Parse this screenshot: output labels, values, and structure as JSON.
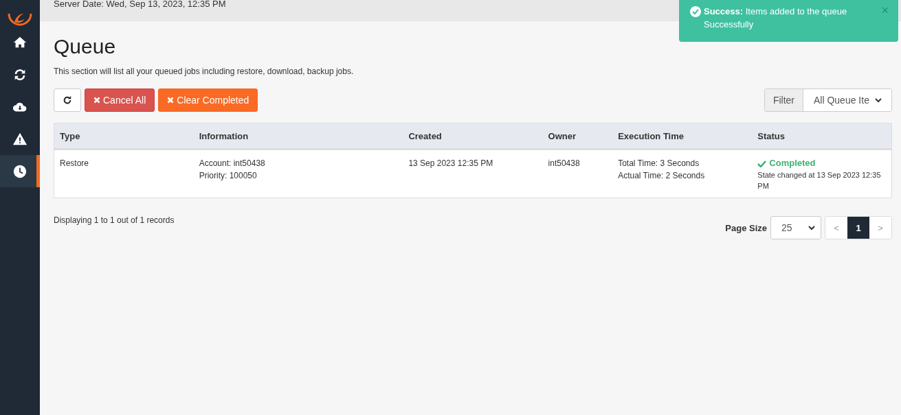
{
  "header": {
    "server_date": "Server Date: Wed, Sep 13, 2023, 12:35 PM"
  },
  "sidebar": {
    "items": [
      {
        "selected": false
      },
      {
        "selected": false
      },
      {
        "selected": false
      },
      {
        "selected": false
      },
      {
        "selected": true
      }
    ]
  },
  "page": {
    "title": "Queue",
    "description": "This section will list all your queued jobs including restore, download, backup jobs."
  },
  "toolbar": {
    "buttons": [
      {
        "kind": "refresh"
      },
      {
        "kind": "danger",
        "label": "Cancel All"
      },
      {
        "kind": "warning",
        "label": "Clear Completed"
      }
    ],
    "filter": {
      "label": "Filter",
      "value": "All Queue Ite"
    }
  },
  "table": {
    "columns": [
      "Type",
      "Information",
      "Created",
      "Owner",
      "Execution Time",
      "Status"
    ],
    "rows": [
      {
        "type": "Restore",
        "information": [
          "Account: int50438",
          "Priority: 100050"
        ],
        "created": "13 Sep 2023 12:35 PM",
        "owner": "int50438",
        "execution_time": [
          "Total Time: 3 Seconds",
          "Actual Time: 2 Seconds"
        ],
        "status": "Completed",
        "status_detail": "State changed at 13 Sep 2023 12:35 PM"
      }
    ]
  },
  "footer": {
    "summary": "Displaying 1 to 1 out of 1 records",
    "page_size_label": "Page Size",
    "page_size": "25",
    "pages": [
      {
        "label": "<",
        "selected": false
      },
      {
        "label": "1",
        "selected": true
      },
      {
        "label": ">",
        "selected": false
      }
    ]
  },
  "toast": {
    "title": "Success:",
    "message": "Items added to the queue Successfully",
    "close": "×"
  }
}
